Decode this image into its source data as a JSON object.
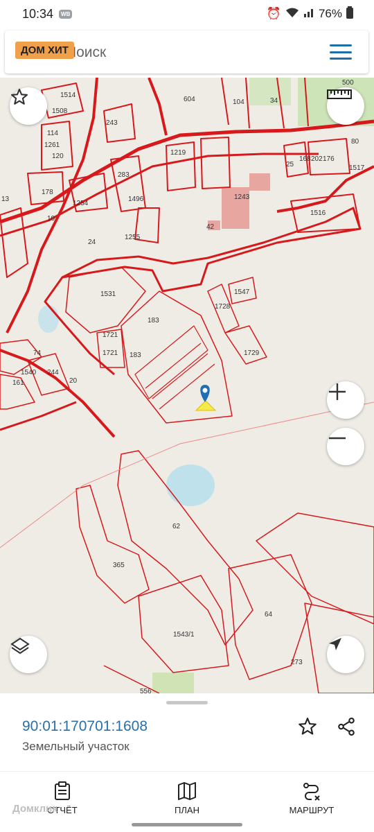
{
  "status_bar": {
    "time": "10:34",
    "badge": "WB",
    "battery": "76%"
  },
  "search": {
    "placeholder": "Поиск",
    "brand_logo": "ДОМ ХИТ"
  },
  "map": {
    "plot_numbers": [
      "1514",
      "1508",
      "243",
      "114",
      "1261",
      "120",
      "178",
      "13",
      "1254",
      "10",
      "283",
      "1496",
      "1219",
      "604",
      "104",
      "34",
      "500",
      "80",
      "25",
      "168",
      "202",
      "176",
      "1517",
      "1243",
      "1516",
      "42",
      "1255",
      "24",
      "1531",
      "1547",
      "1728",
      "183",
      "1721",
      "1721",
      "183",
      "1729",
      "74",
      "1540",
      "244",
      "161",
      "20",
      "62",
      "365",
      "64",
      "1543/1",
      "273",
      "556"
    ],
    "accent_color": "#d7191c",
    "marker_color": "#1f6fb2",
    "highlight_color": "#f6e94a"
  },
  "parcel": {
    "cadastral_number": "90:01:170701:1608",
    "type": "Земельный участок"
  },
  "nav": {
    "report": "ОТЧЁТ",
    "plan": "ПЛАН",
    "route": "МАРШРУТ"
  },
  "watermark": "Домклик"
}
